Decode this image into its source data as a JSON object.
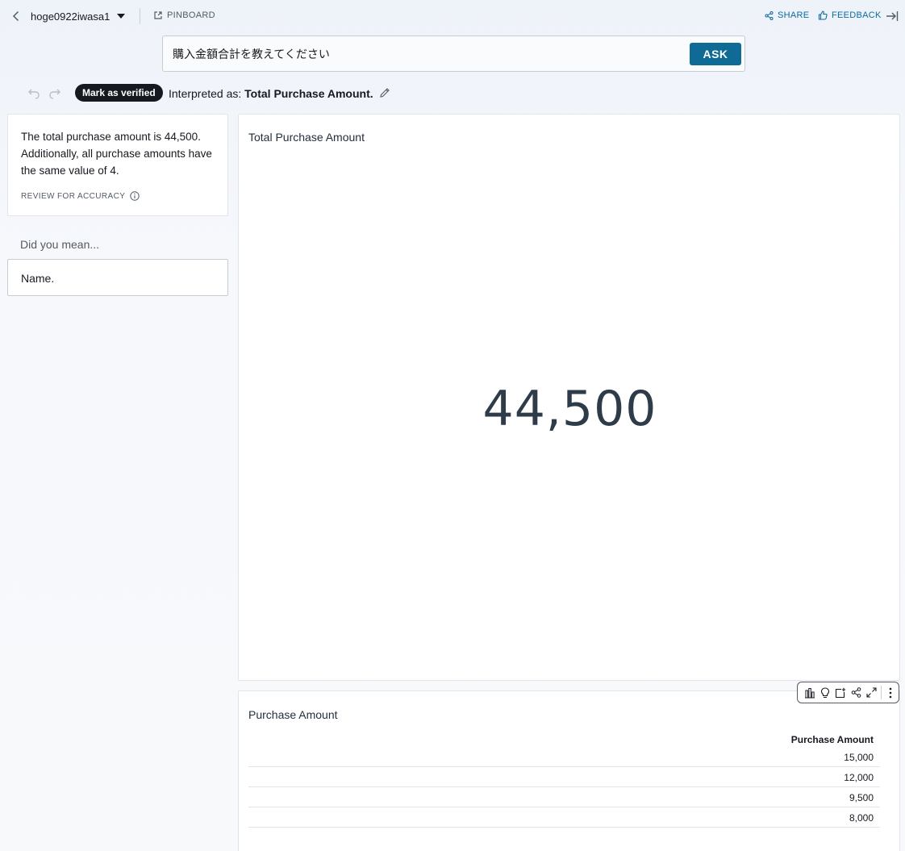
{
  "header": {
    "dataset_name": "hoge0922iwasa1",
    "pinboard_label": "PINBOARD",
    "share_label": "SHARE",
    "feedback_label": "FEEDBACK"
  },
  "question": {
    "value": "購入金額合計を教えてください",
    "ask_label": "ASK"
  },
  "interpretation": {
    "verify_label": "Mark as verified",
    "prefix": "Interpreted as: ",
    "text": "Total Purchase Amount."
  },
  "summary": {
    "text": "The total purchase amount is 44,500. Additionally, all purchase amounts have the same value of 4.",
    "review_label": "REVIEW FOR ACCURACY"
  },
  "suggestions": {
    "heading": "Did you mean...",
    "items": [
      "Name."
    ]
  },
  "kpi": {
    "title": "Total Purchase Amount",
    "value": "44,500"
  },
  "table": {
    "title": "Purchase Amount",
    "column_header": "Purchase Amount",
    "rows": [
      "15,000",
      "12,000",
      "9,500",
      "8,000"
    ]
  },
  "colors": {
    "accent": "#0f6b96",
    "link": "#0b6b9f",
    "kpi_text": "#2e3b49"
  },
  "icons": {
    "toolbar": [
      "bar-chart-icon",
      "lightbulb-icon",
      "add-to-pinboard-icon",
      "share-icon",
      "expand-icon",
      "more-icon"
    ]
  }
}
